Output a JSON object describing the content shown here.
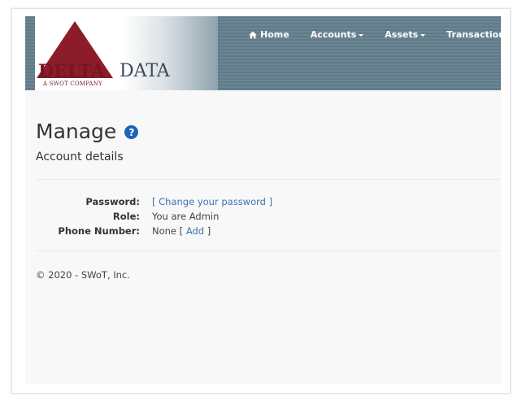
{
  "brand": {
    "name_part1": "DELTA",
    "name_part2": "DATA",
    "tagline": "A SWoT COMPANY"
  },
  "nav": {
    "items": [
      {
        "label": "Home",
        "icon": "home-icon",
        "dropdown": false
      },
      {
        "label": "Accounts",
        "dropdown": true
      },
      {
        "label": "Assets",
        "dropdown": true
      },
      {
        "label": "Transactions",
        "dropdown": false
      }
    ]
  },
  "page": {
    "title": "Manage",
    "help_icon": "?",
    "subtitle": "Account details"
  },
  "details": {
    "password_label": "Password:",
    "password_open": "[ ",
    "password_link": "Change your password",
    "password_close": " ]",
    "role_label": "Role:",
    "role_value": "You are Admin",
    "phone_label": "Phone Number:",
    "phone_value": "None [ ",
    "phone_link": "Add",
    "phone_close": " ]"
  },
  "footer": {
    "text": "© 2020 - SWoT, Inc."
  },
  "colors": {
    "brand_red": "#8c1c2a",
    "nav_bg": "#647e8c",
    "link": "#3c73b0",
    "help": "#1f63b5"
  }
}
